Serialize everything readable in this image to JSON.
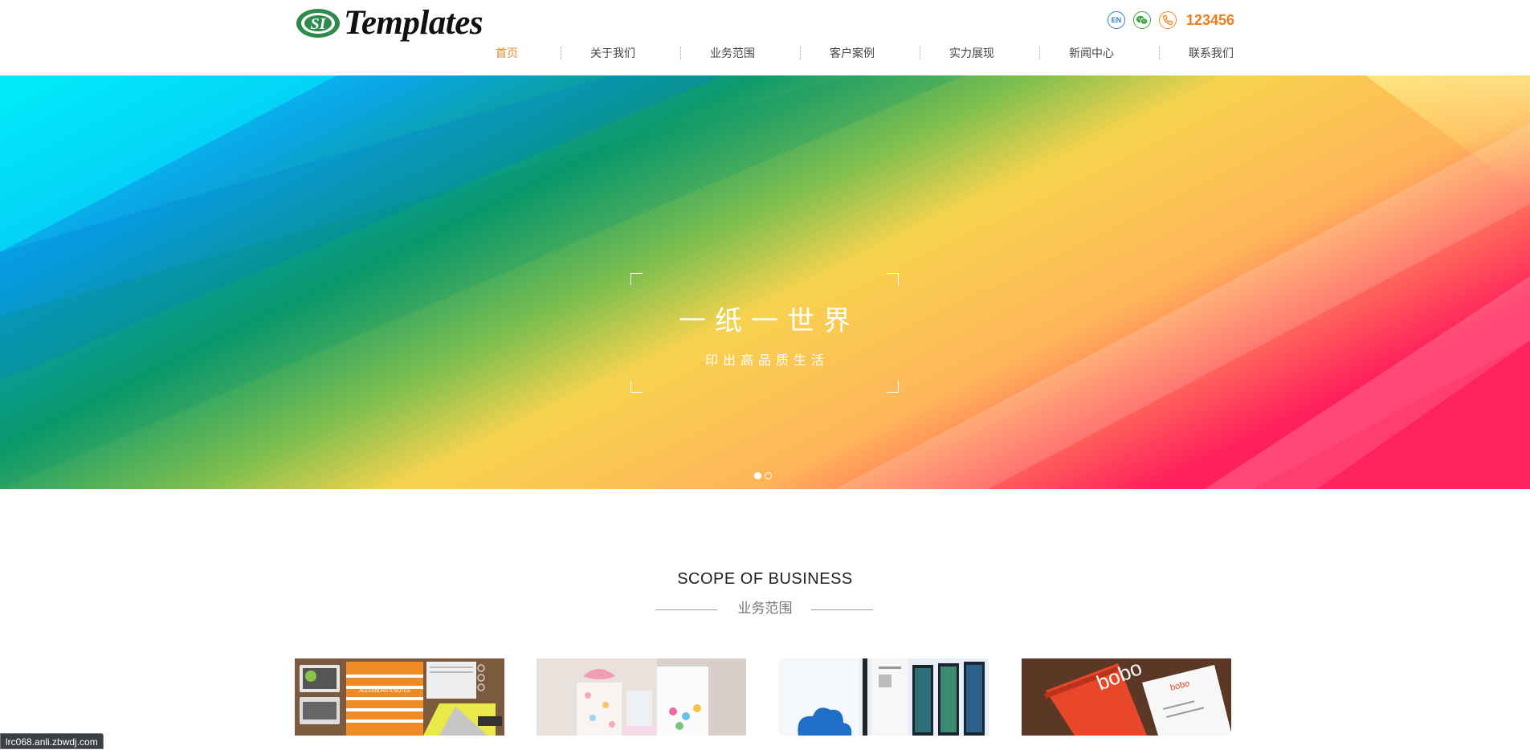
{
  "brand": {
    "logo_text": "Templates",
    "logo_mark": "SI"
  },
  "header": {
    "lang_label": "EN",
    "phone": "123456",
    "colors": {
      "lang": "#2f7fd3",
      "wechat": "#3aa441",
      "phone": "#ef7d1a"
    }
  },
  "nav": {
    "items": [
      "首页",
      "关于我们",
      "业务范围",
      "客户案例",
      "实力展现",
      "新闻中心",
      "联系我们"
    ],
    "active_index": 0,
    "active_color": "#e08a2c"
  },
  "banner": {
    "title": "一纸一世界",
    "subtitle": "印出高品质生活",
    "slide_count": 2,
    "current_slide": 1
  },
  "scope": {
    "title_en": "SCOPE OF BUSINESS",
    "title_cn": "业务范围",
    "cards": [
      {
        "name": "stationery-mockup",
        "caption": "ALEXANDRA'S NOTES"
      },
      {
        "name": "gift-packaging"
      },
      {
        "name": "poster-frames"
      },
      {
        "name": "business-cards",
        "brand_text": "bobo"
      }
    ]
  },
  "status_url": "lrc068.anli.zbwdj.com"
}
